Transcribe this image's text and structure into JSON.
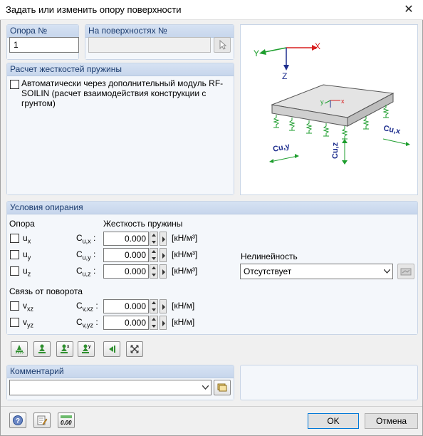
{
  "window": {
    "title": "Задать или изменить опору поверхности",
    "close_glyph": "✕"
  },
  "support_no": {
    "label": "Опора №",
    "value": "1"
  },
  "on_surfaces": {
    "label": "На поверхностях №",
    "value": ""
  },
  "spring_calc": {
    "title": "Расчет жесткостей пружины",
    "option_label": "Автоматически через дополнительный модуль RF-SOILIN (расчет взаимодействия конструкции с грунтом)",
    "checked": false
  },
  "diagram": {
    "axis_x": "X",
    "axis_y": "Y",
    "axis_z": "Z",
    "local_y": "y",
    "local_x": "x",
    "cuy": "Cu,y",
    "cux": "Cu,x",
    "cuz": "Cu,z",
    "colors": {
      "x": "#d81e1e",
      "y": "#1e9e2e",
      "z": "#1e2e8e"
    }
  },
  "conditions": {
    "title": "Условия опирания",
    "support_header": "Опора",
    "stiffness_header": "Жесткость пружины",
    "translational": [
      {
        "name": "u",
        "sub": "x",
        "coef": "C",
        "coef_sub": "u,x",
        "value": "0.000",
        "unit": "[кН/м³]",
        "checked": false
      },
      {
        "name": "u",
        "sub": "y",
        "coef": "C",
        "coef_sub": "u,y",
        "value": "0.000",
        "unit": "[кН/м³]",
        "checked": false
      },
      {
        "name": "u",
        "sub": "z",
        "coef": "C",
        "coef_sub": "u,z",
        "value": "0.000",
        "unit": "[кН/м³]",
        "checked": false
      }
    ],
    "rotation_header": "Связь от поворота",
    "rotational": [
      {
        "name": "v",
        "sub": "xz",
        "coef": "C",
        "coef_sub": "v,xz",
        "value": "0.000",
        "unit": "[кН/м]",
        "checked": false
      },
      {
        "name": "v",
        "sub": "yz",
        "coef": "C",
        "coef_sub": "v,yz",
        "value": "0.000",
        "unit": "[кН/м]",
        "checked": false
      }
    ],
    "nonlinearity_label": "Нелинейность",
    "nonlinearity_value": "Отсутствует"
  },
  "toolbar": {
    "buttons": [
      {
        "icon": "support-fixed-icon"
      },
      {
        "icon": "support-hinged-icon"
      },
      {
        "icon": "support-sliding-x-icon",
        "mark": "x"
      },
      {
        "icon": "support-sliding-y-icon",
        "mark": "y"
      },
      {
        "icon": "support-side-icon"
      },
      {
        "icon": "support-free-icon"
      }
    ]
  },
  "comment": {
    "title": "Комментарий",
    "value": ""
  },
  "footer": {
    "ok": "OK",
    "cancel": "Отмена",
    "units_badge": "0.00"
  }
}
